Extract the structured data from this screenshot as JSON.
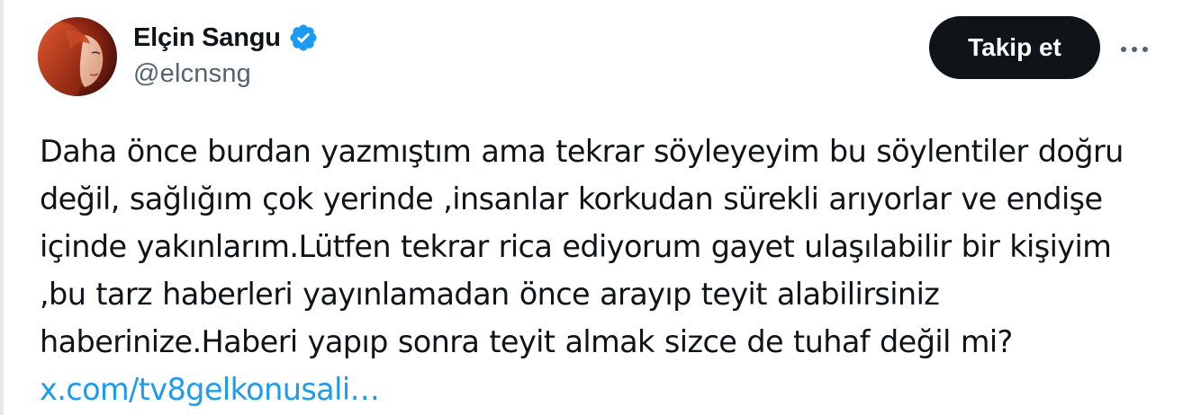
{
  "tweet": {
    "author": {
      "display_name": "Elçin Sangu",
      "handle": "@elcnsng",
      "verified": true,
      "avatar": "profile-photo"
    },
    "follow_label": "Takip et",
    "more_icon": "ellipsis-icon",
    "text_lines": [
      "Daha önce burdan yazmıştım ama tekrar söyleyeyim bu söylentiler doğru",
      "değil, sağlığım çok yerinde ,insanlar korkudan sürekli arıyorlar ve endişe",
      "içinde yakınlarım.Lütfen tekrar rica ediyorum gayet ulaşılabilir bir kişiyim",
      ",bu tarz haberleri yayınlamadan önce arayıp teyit alabilirsiniz",
      "haberinize.Haberi yapıp sonra teyit almak sizce de tuhaf değil mi?"
    ],
    "link": "x.com/tv8gelkonusali…"
  },
  "colors": {
    "accent": "#1d9bf0",
    "text": "#0f1419",
    "secondary": "#536471",
    "button_bg": "#0f1419"
  }
}
